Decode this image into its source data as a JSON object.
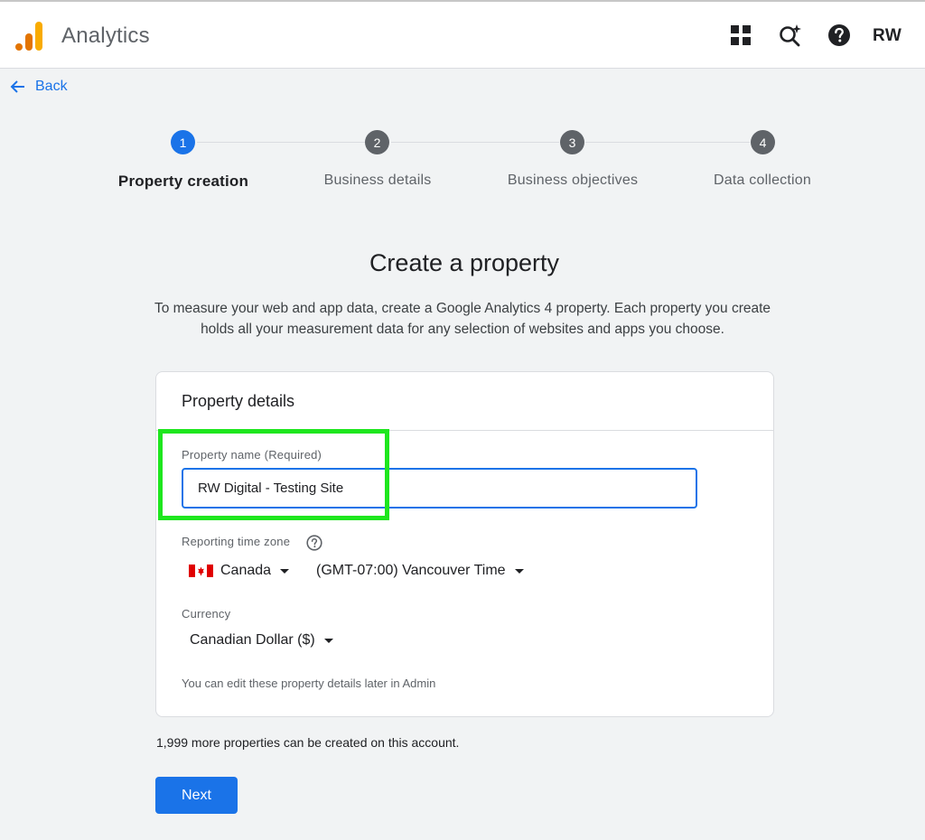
{
  "header": {
    "app_title": "Analytics",
    "icons": [
      "apps-grid-icon",
      "search-spark-icon",
      "help-icon"
    ],
    "avatar_initials": "RW"
  },
  "back": {
    "label": "Back",
    "icon": "arrow-left-icon"
  },
  "stepper": {
    "steps": [
      {
        "number": "1",
        "label": "Property creation",
        "active": true
      },
      {
        "number": "2",
        "label": "Business details",
        "active": false
      },
      {
        "number": "3",
        "label": "Business objectives",
        "active": false
      },
      {
        "number": "4",
        "label": "Data collection",
        "active": false
      }
    ]
  },
  "page": {
    "title": "Create a property",
    "intro_line1": "To measure your web and app data, create a Google Analytics 4 property. Each property you create",
    "intro_line2": "holds all your measurement data for any selection of websites and apps you choose."
  },
  "card": {
    "title": "Property details",
    "property_name": {
      "label": "Property name (Required)",
      "value": "RW Digital - Testing Site"
    },
    "time_zone": {
      "label": "Reporting time zone",
      "country": "Canada",
      "zone": "(GMT-07:00) Vancouver Time"
    },
    "currency": {
      "label": "Currency",
      "value": "Canadian Dollar ($)"
    },
    "note": "You can edit these property details later in Admin"
  },
  "footer": {
    "remaining": "1,999 more properties can be created on this account.",
    "next_label": "Next"
  },
  "colors": {
    "accent": "#1a73e8",
    "highlight": "#1ee61e",
    "step_inactive": "#5f6368"
  }
}
